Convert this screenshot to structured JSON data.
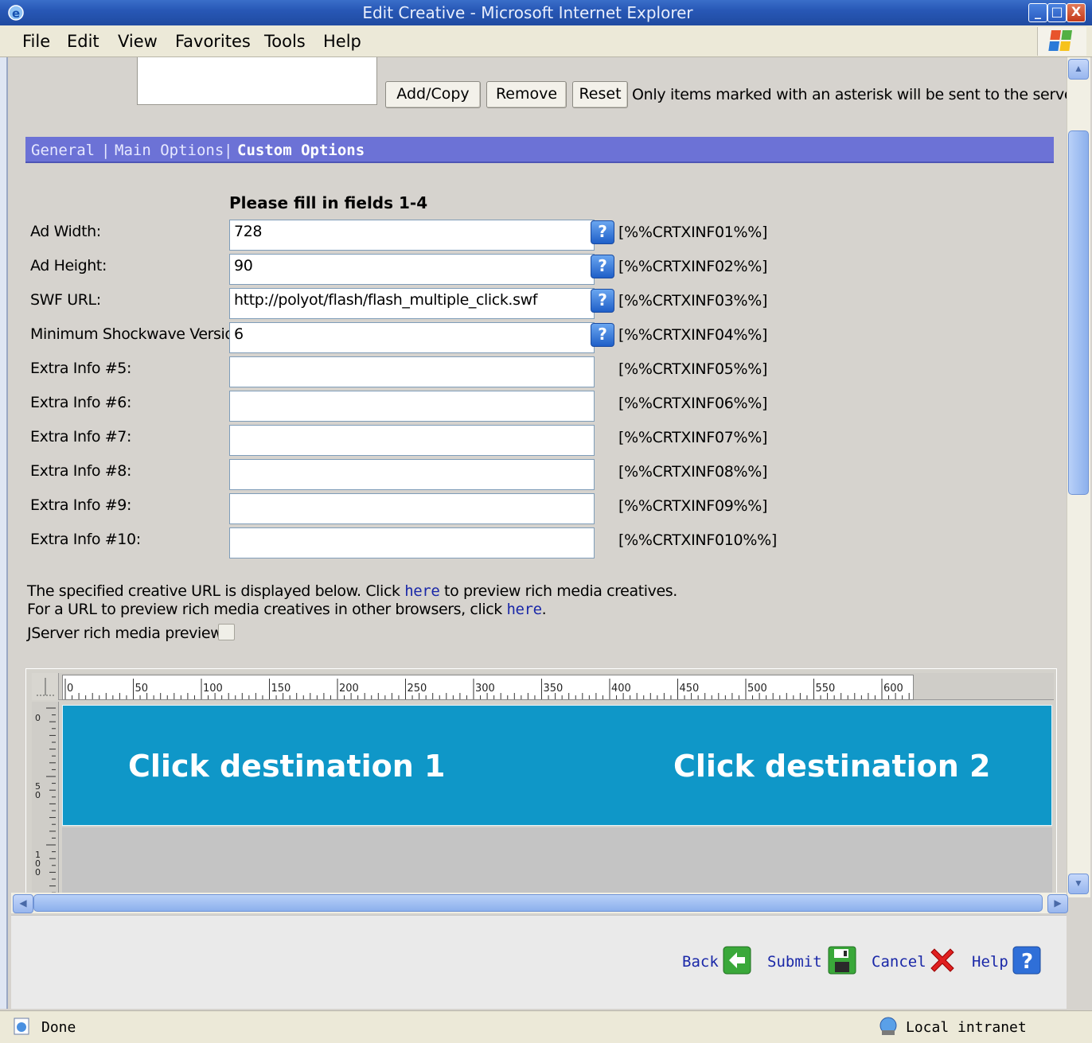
{
  "window": {
    "title": "Edit Creative - Microsoft Internet Explorer"
  },
  "menu": [
    "File",
    "Edit",
    "View",
    "Favorites",
    "Tools",
    "Help"
  ],
  "toolbar": {
    "add_copy": "Add/Copy",
    "remove": "Remove",
    "reset": "Reset",
    "note": "Only items marked with an asterisk will be sent to the server."
  },
  "tabs": {
    "general": "General",
    "main_options": "Main Options",
    "custom_options": "Custom Options",
    "separator": "|"
  },
  "form": {
    "heading": "Please fill in fields 1-4",
    "help_glyph": "?",
    "rows": [
      {
        "label": "Ad Width:",
        "value": "728",
        "token": "[%%CRTXINF01%%]",
        "help": true
      },
      {
        "label": "Ad Height:",
        "value": "90",
        "token": "[%%CRTXINF02%%]",
        "help": true
      },
      {
        "label": "SWF URL:",
        "value": "http://polyot/flash/flash_multiple_click.swf",
        "token": "[%%CRTXINF03%%]",
        "help": true
      },
      {
        "label": "Minimum Shockwave Version:",
        "value": "6",
        "token": "[%%CRTXINF04%%]",
        "help": true
      },
      {
        "label": "Extra Info #5:",
        "value": "",
        "token": "[%%CRTXINF05%%]",
        "help": false
      },
      {
        "label": "Extra Info #6:",
        "value": "",
        "token": "[%%CRTXINF06%%]",
        "help": false
      },
      {
        "label": "Extra Info #7:",
        "value": "",
        "token": "[%%CRTXINF07%%]",
        "help": false
      },
      {
        "label": "Extra Info #8:",
        "value": "",
        "token": "[%%CRTXINF08%%]",
        "help": false
      },
      {
        "label": "Extra Info #9:",
        "value": "",
        "token": "[%%CRTXINF09%%]",
        "help": false
      },
      {
        "label": "Extra Info #10:",
        "value": "",
        "token": "[%%CRTXINF010%%]",
        "help": false
      }
    ]
  },
  "preview_text": {
    "line1_before": "The specified creative URL is displayed below. Click ",
    "line1_link": "here",
    "line1_after": " to preview rich media creatives.",
    "line2_before": "For a URL to preview rich media creatives in other browsers, click ",
    "line2_link": "here",
    "line2_after": ".",
    "jserver_label": "JServer rich media preview:"
  },
  "ruler": {
    "top_labels": [
      "0",
      "50",
      "100",
      "150",
      "200",
      "250",
      "300",
      "350",
      "400",
      "450",
      "500",
      "550",
      "600"
    ],
    "left_labels": [
      "0",
      "50",
      "100"
    ]
  },
  "banner": {
    "dest1": "Click destination 1",
    "dest2": "Click destination 2",
    "color": "#0f97c8"
  },
  "actions": {
    "back": "Back",
    "submit": "Submit",
    "cancel": "Cancel",
    "help": "Help"
  },
  "status": {
    "left": "Done",
    "zone": "Local intranet"
  }
}
